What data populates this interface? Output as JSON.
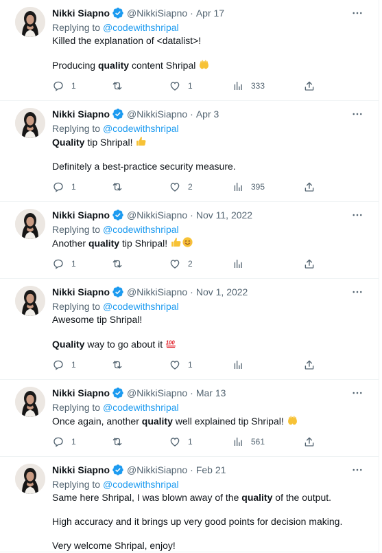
{
  "colors": {
    "accent": "#1d9bf0",
    "muted": "#536471",
    "text": "#0f1419",
    "emoji_yellow": "#f7c236",
    "hundred_red": "#e01b24"
  },
  "tweets": [
    {
      "name": "Nikki Siapno",
      "handle": "@NikkiSiapno",
      "sep": "·",
      "date": "Apr 17",
      "reply_prefix": "Replying to ",
      "reply_to": "@codewithshripal",
      "lines": [
        {
          "parts": [
            {
              "t": "Killed the explanation of <datalist>!"
            }
          ]
        },
        {
          "parts": [
            {
              "t": "Producing "
            },
            {
              "t": "quality",
              "b": true
            },
            {
              "t": " content Shripal "
            }
          ],
          "emoji": [
            "raising-hands-emoji"
          ]
        }
      ],
      "replies": "1",
      "retweets": "",
      "likes": "1",
      "views": "333"
    },
    {
      "name": "Nikki Siapno",
      "handle": "@NikkiSiapno",
      "sep": "·",
      "date": "Apr 3",
      "reply_prefix": "Replying to ",
      "reply_to": "@codewithshripal",
      "lines": [
        {
          "parts": [
            {
              "t": "Quality",
              "b": true
            },
            {
              "t": " tip Shripal! "
            }
          ],
          "emoji": [
            "thumbs-up-emoji"
          ]
        },
        {
          "parts": [
            {
              "t": "Definitely a best-practice security measure."
            }
          ]
        }
      ],
      "replies": "1",
      "retweets": "",
      "likes": "2",
      "views": "395"
    },
    {
      "name": "Nikki Siapno",
      "handle": "@NikkiSiapno",
      "sep": "·",
      "date": "Nov 11, 2022",
      "reply_prefix": "Replying to ",
      "reply_to": "@codewithshripal",
      "lines": [
        {
          "parts": [
            {
              "t": "Another "
            },
            {
              "t": "quality",
              "b": true
            },
            {
              "t": " tip Shripal! "
            }
          ],
          "emoji": [
            "thumbs-up-emoji",
            "smiling-face-emoji"
          ]
        }
      ],
      "replies": "1",
      "retweets": "",
      "likes": "2",
      "views": ""
    },
    {
      "name": "Nikki Siapno",
      "handle": "@NikkiSiapno",
      "sep": "·",
      "date": "Nov 1, 2022",
      "reply_prefix": "Replying to ",
      "reply_to": "@codewithshripal",
      "lines": [
        {
          "parts": [
            {
              "t": "Awesome tip Shripal!"
            }
          ]
        },
        {
          "parts": [
            {
              "t": "Quality",
              "b": true
            },
            {
              "t": " way to go about it "
            }
          ],
          "emoji": [
            "hundred-points-emoji"
          ]
        }
      ],
      "replies": "1",
      "retweets": "",
      "likes": "1",
      "views": ""
    },
    {
      "name": "Nikki Siapno",
      "handle": "@NikkiSiapno",
      "sep": "·",
      "date": "Mar 13",
      "reply_prefix": "Replying to ",
      "reply_to": "@codewithshripal",
      "lines": [
        {
          "parts": [
            {
              "t": "Once again, another "
            },
            {
              "t": "quality",
              "b": true
            },
            {
              "t": " well explained tip Shripal! "
            }
          ],
          "emoji": [
            "raising-hands-emoji"
          ]
        }
      ],
      "replies": "1",
      "retweets": "",
      "likes": "1",
      "views": "561"
    },
    {
      "name": "Nikki Siapno",
      "handle": "@NikkiSiapno",
      "sep": "·",
      "date": "Feb 21",
      "reply_prefix": "Replying to ",
      "reply_to": "@codewithshripal",
      "lines": [
        {
          "parts": [
            {
              "t": "Same here Shripal, I was blown away of the "
            },
            {
              "t": "quality",
              "b": true
            },
            {
              "t": " of the output."
            }
          ]
        },
        {
          "parts": [
            {
              "t": "High accuracy and it brings up very good points for decision making."
            }
          ]
        },
        {
          "parts": [
            {
              "t": "Very welcome Shripal, enjoy!"
            }
          ]
        }
      ],
      "replies": "",
      "retweets": "",
      "likes": "",
      "views": "",
      "no_actions": true
    }
  ]
}
